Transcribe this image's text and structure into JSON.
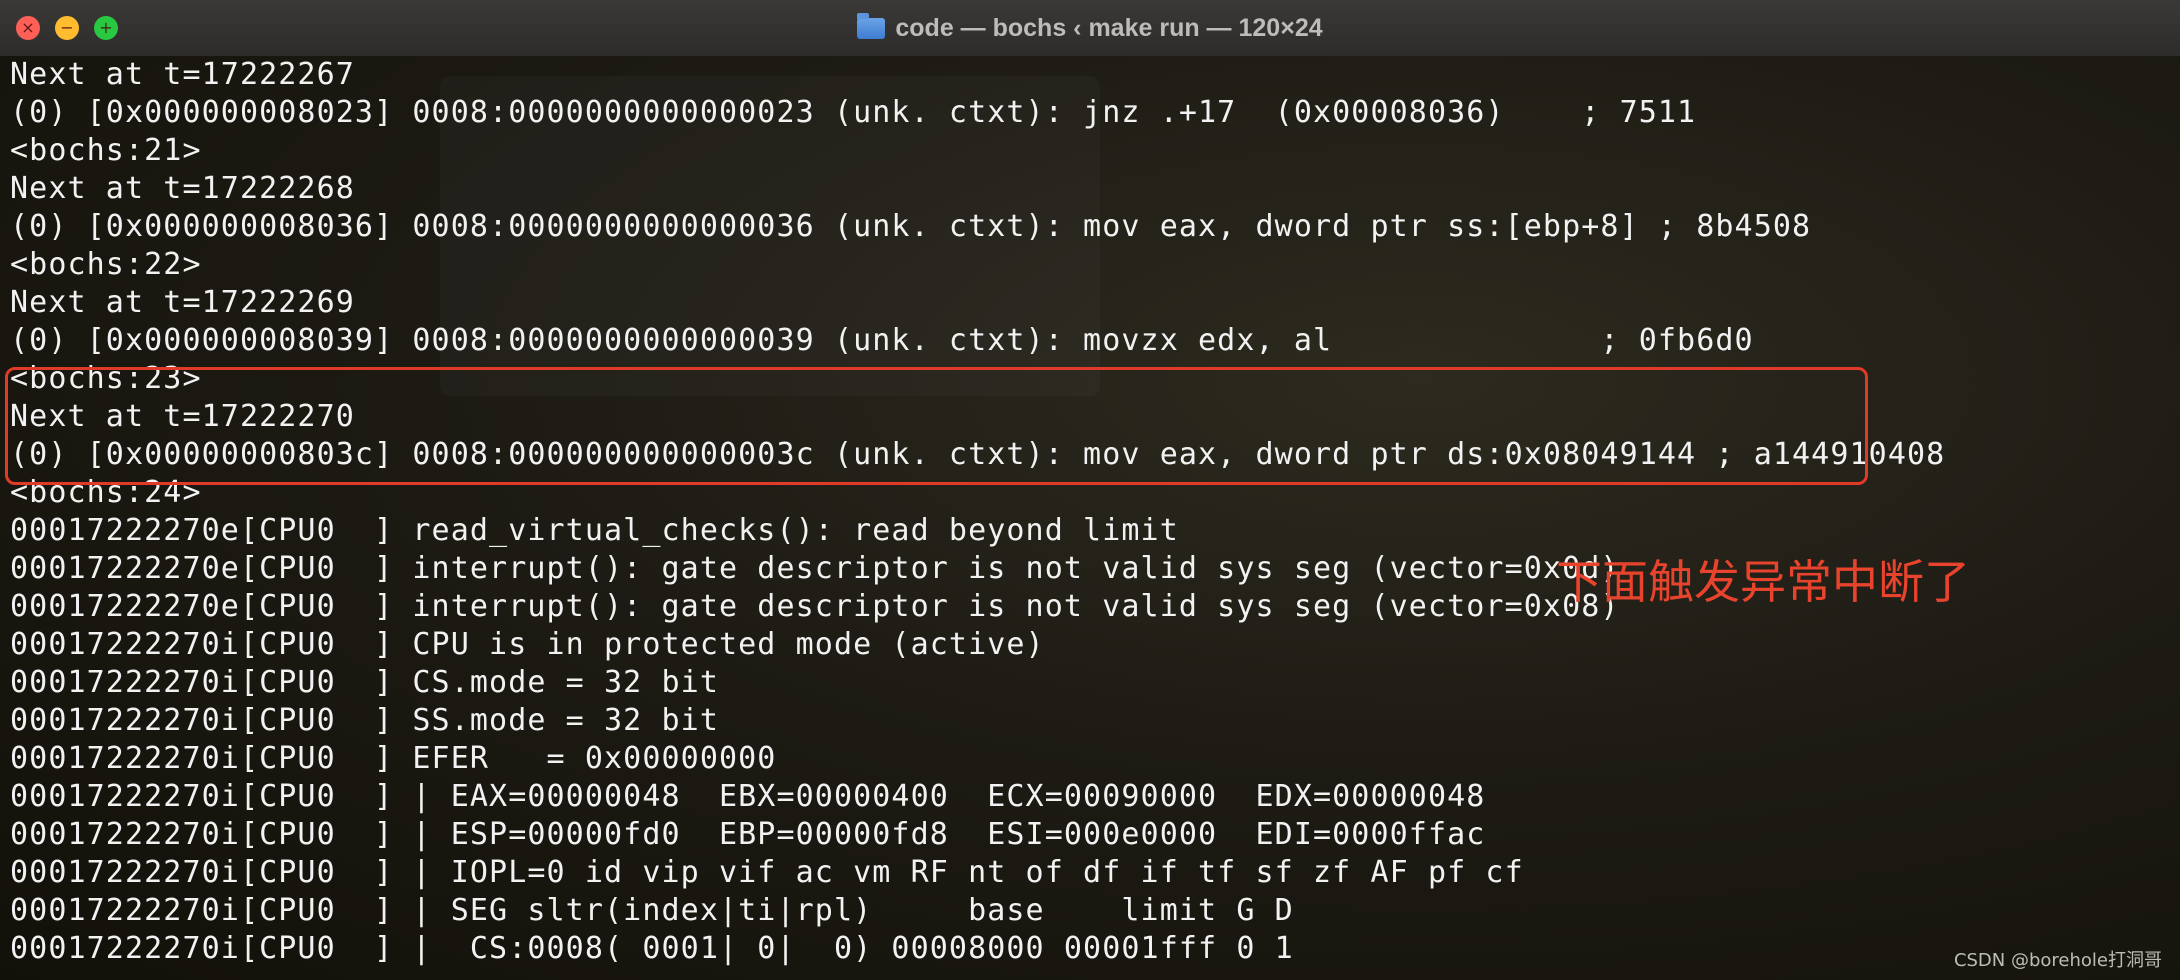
{
  "window": {
    "title": "code — bochs ‹ make run — 120×24",
    "close_glyph": "×",
    "minimize_glyph": "−",
    "maximize_glyph": "+"
  },
  "terminal": {
    "lines": [
      "Next at t=17222267",
      "(0) [0x000000008023] 0008:0000000000000023 (unk. ctxt): jnz .+17  (0x00008036)    ; 7511",
      "<bochs:21>",
      "Next at t=17222268",
      "(0) [0x000000008036] 0008:0000000000000036 (unk. ctxt): mov eax, dword ptr ss:[ebp+8] ; 8b4508",
      "<bochs:22>",
      "Next at t=17222269",
      "(0) [0x000000008039] 0008:0000000000000039 (unk. ctxt): movzx edx, al              ; 0fb6d0",
      "<bochs:23>",
      "Next at t=17222270",
      "(0) [0x00000000803c] 0008:000000000000003c (unk. ctxt): mov eax, dword ptr ds:0x08049144 ; a144910408",
      "<bochs:24>",
      "00017222270e[CPU0  ] read_virtual_checks(): read beyond limit",
      "00017222270e[CPU0  ] interrupt(): gate descriptor is not valid sys seg (vector=0x0d)",
      "00017222270e[CPU0  ] interrupt(): gate descriptor is not valid sys seg (vector=0x08)",
      "00017222270i[CPU0  ] CPU is in protected mode (active)",
      "00017222270i[CPU0  ] CS.mode = 32 bit",
      "00017222270i[CPU0  ] SS.mode = 32 bit",
      "00017222270i[CPU0  ] EFER   = 0x00000000",
      "00017222270i[CPU0  ] | EAX=00000048  EBX=00000400  ECX=00090000  EDX=00000048",
      "00017222270i[CPU0  ] | ESP=00000fd0  EBP=00000fd8  ESI=000e0000  EDI=0000ffac",
      "00017222270i[CPU0  ] | IOPL=0 id vip vif ac vm RF nt of df if tf sf zf AF pf cf",
      "00017222270i[CPU0  ] | SEG sltr(index|ti|rpl)     base    limit G D",
      "00017222270i[CPU0  ] |  CS:0008( 0001| 0|  0) 00008000 00001fff 0 1"
    ]
  },
  "annotation": {
    "text": "下面触发异常中断了",
    "color": "#e8432c"
  },
  "watermark": "CSDN @borehole打洞哥",
  "colors": {
    "terminal_text": "#f2f2f2",
    "highlight_border": "#e03a28"
  }
}
